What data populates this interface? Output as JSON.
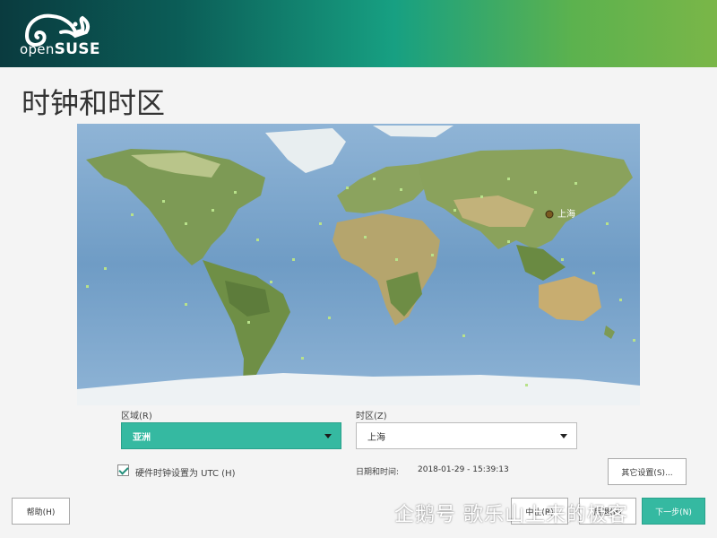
{
  "brand": {
    "logo_icon": "chameleon-icon",
    "name_prefix": "open",
    "name_suffix": "SUSE"
  },
  "page": {
    "title": "时钟和时区"
  },
  "map": {
    "selected_city_label": "上海"
  },
  "region": {
    "label": "区域(R)",
    "value": "亚洲"
  },
  "timezone": {
    "label": "时区(Z)",
    "value": "上海"
  },
  "hardware_clock": {
    "label": "硬件时钟设置为 UTC (H)",
    "checked": true
  },
  "datetime": {
    "label": "日期和时间:",
    "value": "2018-01-29 - 15:39:13"
  },
  "buttons": {
    "other_settings": "其它设置(S)...",
    "help": "帮助(H)",
    "abort": "中止(R)",
    "back": "后退(B)",
    "next": "下一步(N)"
  },
  "watermark": {
    "text": "企鹅号 歌乐山上来的极客"
  },
  "colors": {
    "accent": "#35b9a1",
    "header_dark": "#0a3b3f",
    "header_light": "#7ab648"
  }
}
